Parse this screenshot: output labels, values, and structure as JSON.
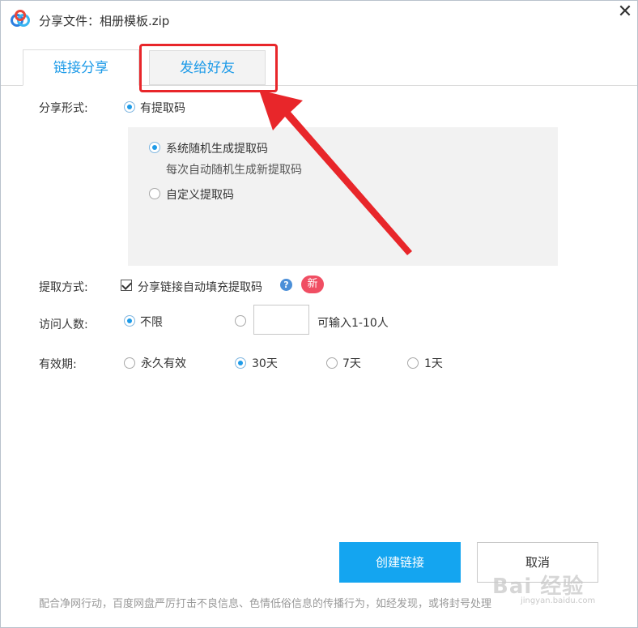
{
  "window": {
    "title": "分享文件：相册模板.zip"
  },
  "tabs": [
    {
      "label": "链接分享",
      "active": true
    },
    {
      "label": "发给好友",
      "active": false
    }
  ],
  "share_form": {
    "label": "分享形式:",
    "option": "有提取码",
    "checked": true
  },
  "code_panel": {
    "random": {
      "label": "系统随机生成提取码",
      "hint": "每次自动随机生成新提取码",
      "checked": true
    },
    "custom": {
      "label": "自定义提取码",
      "checked": false
    }
  },
  "extract_method": {
    "label": "提取方式:",
    "checkbox_label": "分享链接自动填充提取码",
    "checked": true,
    "badge": "新",
    "help_icon": "?"
  },
  "visitors": {
    "label": "访问人数:",
    "unlimited": "不限",
    "unlimited_checked": true,
    "input_value": "",
    "input_hint": "可输入1-10人"
  },
  "validity": {
    "label": "有效期:",
    "options": [
      {
        "label": "永久有效",
        "checked": false
      },
      {
        "label": "30天",
        "checked": true
      },
      {
        "label": "7天",
        "checked": false
      },
      {
        "label": "1天",
        "checked": false
      }
    ]
  },
  "buttons": {
    "create": "创建链接",
    "cancel": "取消"
  },
  "footer": "配合净网行动，百度网盘严厉打击不良信息、色情低俗信息的传播行为，如经发现，或将封号处理",
  "watermark": {
    "text": "Bai 经验",
    "sub": "jingyan.baidu.com"
  },
  "colors": {
    "accent": "#1e9be8",
    "primary_button": "#14a5f0",
    "highlight": "#e8262a",
    "badge": "#f04e63"
  }
}
